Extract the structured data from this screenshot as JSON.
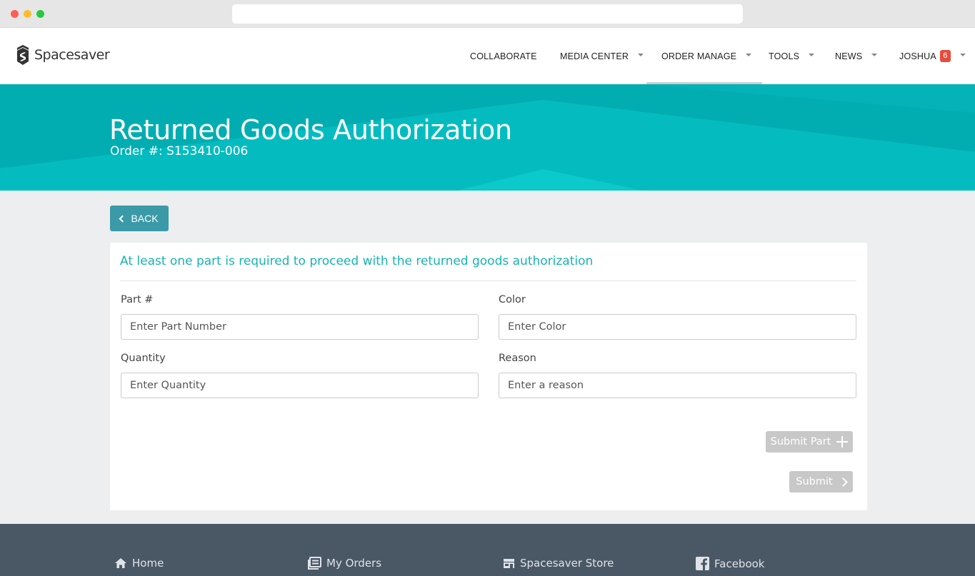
{
  "brand": {
    "name": "Spacesaver",
    "logo_icon": "spacesaver-logo-icon"
  },
  "nav": {
    "items": [
      {
        "label": "COLLABORATE",
        "dropdown": false
      },
      {
        "label": "MEDIA CENTER",
        "dropdown": true
      },
      {
        "label": "ORDER MANAGE",
        "dropdown": true,
        "active": true
      },
      {
        "label": "TOOLS",
        "dropdown": true
      },
      {
        "label": "NEWS",
        "dropdown": true
      },
      {
        "label": "JOSHUA",
        "dropdown": true,
        "badge": "6"
      }
    ]
  },
  "hero": {
    "title": "Returned Goods Authorization",
    "subtitle": "Order #: S153410-006"
  },
  "back_button": {
    "label": "BACK"
  },
  "form": {
    "notice": "At least one part is required to proceed with the returned goods authorization",
    "part": {
      "label": "Part #",
      "placeholder": "Enter Part Number"
    },
    "color": {
      "label": "Color",
      "placeholder": "Enter Color"
    },
    "quantity": {
      "label": "Quantity",
      "placeholder": "Enter Quantity"
    },
    "reason": {
      "label": "Reason",
      "placeholder": "Enter a reason"
    },
    "submit_part_label": "Submit Part",
    "submit_label": "Submit"
  },
  "footer": {
    "links": [
      {
        "label": "Home",
        "icon": "home-icon"
      },
      {
        "label": "My Orders",
        "icon": "orders-icon"
      },
      {
        "label": "Spacesaver Store",
        "icon": "store-icon"
      },
      {
        "label": "Facebook",
        "icon": "facebook-icon"
      }
    ]
  },
  "colors": {
    "accent": "#04bcc0",
    "notice_text": "#16b3b5",
    "back_button": "#3a9aa8",
    "badge": "#e74c3c",
    "footer": "#4a5866",
    "disabled_button": "#c8c8c8"
  }
}
